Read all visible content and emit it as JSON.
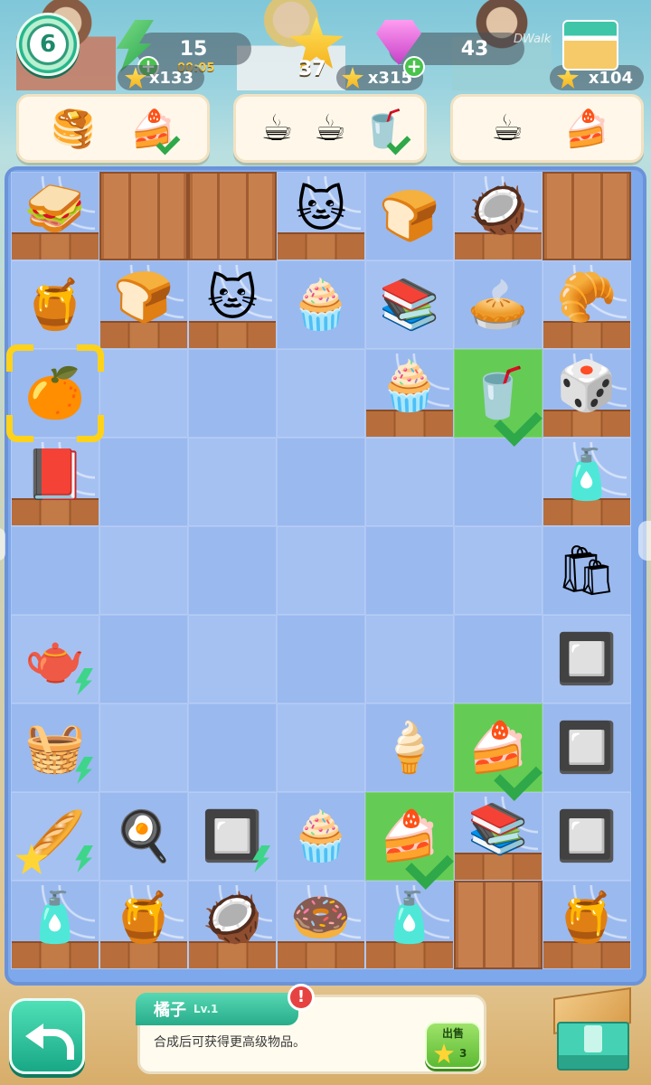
{
  "hud": {
    "level": "6",
    "energy": "15",
    "energy_timer": "00:05",
    "energy_stars": "x133",
    "stars": "37",
    "star_multiplier": "x315",
    "gems": "43",
    "shop_stars": "x104",
    "watermark": "DWalk"
  },
  "orders": [
    {
      "items": [
        {
          "name": "pancake-icon",
          "emoji": "🥞",
          "done": false
        },
        {
          "name": "cake-slice-icon",
          "emoji": "🍰",
          "done": true
        }
      ]
    },
    {
      "items": [
        {
          "name": "latte-cup-icon",
          "emoji": "☕",
          "done": false
        },
        {
          "name": "coffee-cup-icon",
          "emoji": "☕",
          "done": false
        },
        {
          "name": "fruit-jar-drink-icon",
          "emoji": "🥤",
          "done": true
        }
      ]
    },
    {
      "items": [
        {
          "name": "hot-cocoa-icon",
          "emoji": "☕",
          "done": false
        },
        {
          "name": "cherry-cake-icon",
          "emoji": "🍰",
          "done": false
        }
      ]
    }
  ],
  "board": {
    "rows": [
      [
        {
          "name": "sandwich-icon",
          "emoji": "🥪",
          "web": true,
          "wood": true
        },
        {
          "crate": true
        },
        {
          "crate": true
        },
        {
          "name": "cat-icon",
          "emoji": "🐱",
          "web": true,
          "wood": true
        },
        {
          "name": "bread-box-icon",
          "emoji": "🍞"
        },
        {
          "name": "coconut-icon",
          "emoji": "🥥",
          "web": true,
          "wood": true
        },
        {
          "crate": true
        }
      ],
      [
        {
          "name": "honeycomb-icon",
          "emoji": "🍯"
        },
        {
          "name": "bread-box-icon",
          "emoji": "🍞",
          "web": true,
          "wood": true
        },
        {
          "name": "cat-icon",
          "emoji": "🐱",
          "web": true,
          "wood": true
        },
        {
          "name": "cupcake-icon",
          "emoji": "🧁"
        },
        {
          "name": "books-icon",
          "emoji": "📚"
        },
        {
          "name": "fruit-tart-icon",
          "emoji": "🥧"
        },
        {
          "name": "croissant-icon",
          "emoji": "🥐",
          "web": true,
          "wood": true
        }
      ],
      [
        {
          "name": "orange-icon",
          "emoji": "🍊",
          "selected": true
        },
        {},
        {},
        {},
        {
          "name": "cupcake-icon",
          "emoji": "🧁",
          "web": true,
          "wood": true
        },
        {
          "name": "fruit-jar-drink-icon",
          "emoji": "🥤",
          "green": true,
          "check": true
        },
        {
          "name": "dice-icon",
          "emoji": "🎲",
          "web": true,
          "wood": true
        }
      ],
      [
        {
          "name": "books-icon",
          "emoji": "📕",
          "web": true,
          "wood": true
        },
        {},
        {},
        {},
        {},
        {},
        {
          "name": "bottle-icon",
          "emoji": "🧴",
          "web": true,
          "wood": true
        }
      ],
      [
        {},
        {},
        {},
        {},
        {},
        {},
        {
          "name": "shopping-bag-icon",
          "emoji": "🛍"
        }
      ],
      [
        {
          "name": "tea-tray-generator-icon",
          "emoji": "🫖",
          "bolt": true
        },
        {},
        {},
        {},
        {},
        {},
        {
          "name": "oven-icon",
          "emoji": "🔲"
        }
      ],
      [
        {
          "name": "fruit-basket-generator-icon",
          "emoji": "🧺",
          "bolt": true
        },
        {},
        {},
        {},
        {
          "name": "ice-cream-icon",
          "emoji": "🍦"
        },
        {
          "name": "cake-slice-icon",
          "emoji": "🍰",
          "green": true,
          "check": true
        },
        {
          "name": "oven-icon",
          "emoji": "🔲"
        }
      ],
      [
        {
          "name": "bread-basket-generator-icon",
          "emoji": "🥖",
          "bolt": true,
          "star": true
        },
        {
          "name": "baking-tray-icon",
          "emoji": "🍳"
        },
        {
          "name": "oven-generator-icon",
          "emoji": "🔲",
          "bolt": true
        },
        {
          "name": "cherry-cupcake-icon",
          "emoji": "🧁"
        },
        {
          "name": "cake-slice-icon",
          "emoji": "🍰",
          "green": true,
          "check": true
        },
        {
          "name": "books-icon",
          "emoji": "📚",
          "web": true,
          "wood": true
        },
        {
          "name": "toaster-icon",
          "emoji": "🔲"
        }
      ],
      [
        {
          "name": "flower-bottle-icon",
          "emoji": "🧴",
          "web": true,
          "wood": true
        },
        {
          "name": "honeycomb-icon",
          "emoji": "🍯",
          "web": true,
          "wood": true
        },
        {
          "name": "coconut-icon",
          "emoji": "🥥",
          "web": true,
          "wood": true
        },
        {
          "name": "donut-icon",
          "emoji": "🍩",
          "web": true,
          "wood": true
        },
        {
          "name": "perfume-bottle-icon",
          "emoji": "🧴",
          "web": true,
          "wood": true
        },
        {
          "crate": true
        },
        {
          "name": "jam-jar-icon",
          "emoji": "🍯",
          "web": true,
          "wood": true
        }
      ]
    ]
  },
  "info": {
    "title": "橘子",
    "level": "Lv.1",
    "alert": "!",
    "description": "合成后可获得更高级物品。",
    "sell_label": "出售",
    "sell_price": "3"
  }
}
